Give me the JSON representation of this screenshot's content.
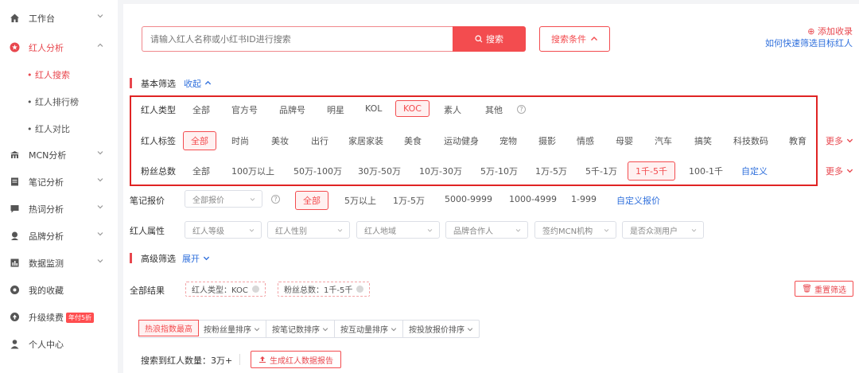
{
  "sidebar": {
    "items": [
      {
        "label": "工作台",
        "icon": "home-icon"
      },
      {
        "label": "红人分析",
        "icon": "star-icon"
      },
      {
        "label": "MCN分析",
        "icon": "building-icon"
      },
      {
        "label": "笔记分析",
        "icon": "note-icon"
      },
      {
        "label": "热词分析",
        "icon": "chat-icon"
      },
      {
        "label": "品牌分析",
        "icon": "brand-icon"
      },
      {
        "label": "数据监测",
        "icon": "monitor-icon"
      },
      {
        "label": "我的收藏",
        "icon": "bookmark-icon"
      },
      {
        "label": "升级续费",
        "icon": "upgrade-icon",
        "badge": "年付5折"
      },
      {
        "label": "个人中心",
        "icon": "user-icon"
      }
    ],
    "subitems": [
      {
        "label": "• 红人搜索"
      },
      {
        "label": "• 红人排行榜"
      },
      {
        "label": "• 红人对比"
      }
    ]
  },
  "search": {
    "placeholder": "请输入红人名称或小红书ID进行搜索",
    "button": "搜索",
    "conditions": "搜索条件"
  },
  "top_links": {
    "add_record": "添加收录",
    "how_to": "如何快速筛选目标红人"
  },
  "basic": {
    "title": "基本筛选",
    "toggle": "收起"
  },
  "advanced": {
    "title": "高级筛选",
    "toggle": "展开"
  },
  "type_row": {
    "label": "红人类型",
    "options": [
      "全部",
      "官方号",
      "品牌号",
      "明星",
      "KOL",
      "KOC",
      "素人",
      "其他"
    ],
    "help": "?"
  },
  "tag_row": {
    "label": "红人标签",
    "options": [
      "全部",
      "时尚",
      "美妆",
      "出行",
      "家居家装",
      "美食",
      "运动健身",
      "宠物",
      "摄影",
      "情感",
      "母婴",
      "汽车",
      "搞笑",
      "科技数码",
      "教育"
    ],
    "more": "更多"
  },
  "fans_row": {
    "label": "粉丝总数",
    "options": [
      "全部",
      "100万以上",
      "50万-100万",
      "30万-50万",
      "10万-30万",
      "5万-10万",
      "1万-5万",
      "5千-1万",
      "1千-5千",
      "100-1千"
    ],
    "custom": "自定义",
    "more": "更多"
  },
  "price_row": {
    "label": "笔记报价",
    "dropdown": "全部报价",
    "help": "?",
    "options": [
      "全部",
      "5万以上",
      "1万-5万",
      "5000-9999",
      "1000-4999",
      "1-999"
    ],
    "custom": "自定义报价"
  },
  "attr_row": {
    "label": "红人属性",
    "dropdowns": [
      "红人等级",
      "红人性别",
      "红人地域",
      "品牌合作人",
      "签约MCN机构",
      "是否众测用户"
    ]
  },
  "results": {
    "label": "全部结果",
    "chips": [
      "红人类型：KOC",
      "粉丝总数：1千-5千"
    ],
    "reset": "重置筛选"
  },
  "sort": {
    "tabs": [
      "热浪指数最高",
      "按粉丝量排序",
      "按笔记数排序",
      "按互动量排序",
      "按投放报价排序"
    ]
  },
  "footer": {
    "count": "搜索到红人数量：3万+",
    "report": "生成红人数据报告"
  },
  "colors": {
    "accent": "#f34c4f",
    "link": "#2f6fdc",
    "highlight_box": "#e02424"
  }
}
